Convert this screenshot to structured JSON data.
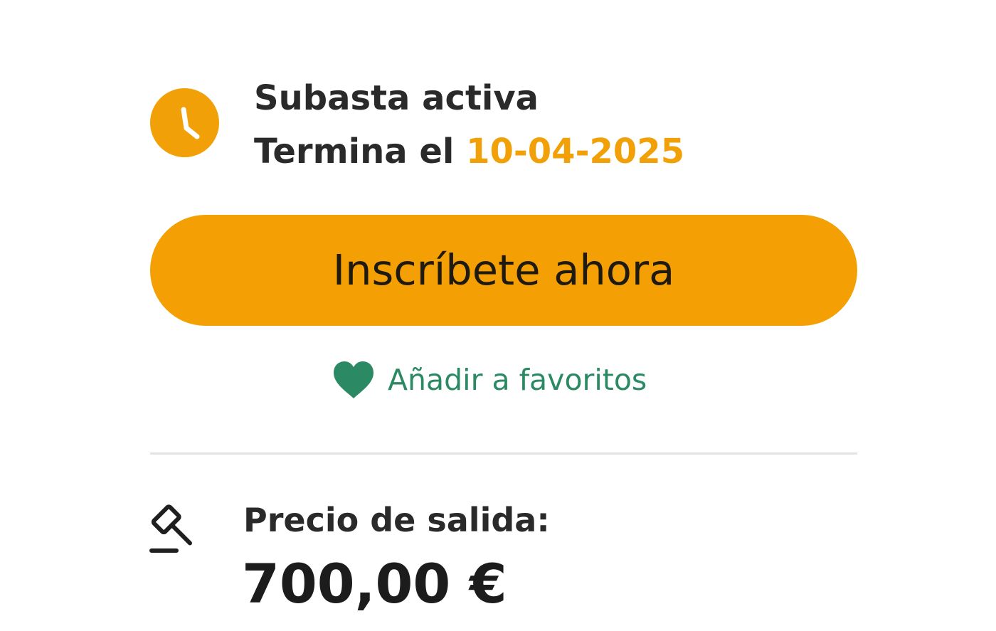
{
  "auction_status": {
    "title": "Subasta activa",
    "ends_prefix": "Termina el ",
    "end_date": "10-04-2025",
    "icon": "clock-icon"
  },
  "cta": {
    "label": "Inscríbete ahora"
  },
  "favorites": {
    "label": "Añadir a favoritos",
    "icon": "heart-icon"
  },
  "price": {
    "label": "Precio de salida:",
    "value": "700,00 €",
    "icon": "gavel-icon"
  },
  "colors": {
    "accent": "#f4a004",
    "favorites": "#2b8a63",
    "text": "#2a2a2a",
    "divider": "#e3e3e3"
  }
}
